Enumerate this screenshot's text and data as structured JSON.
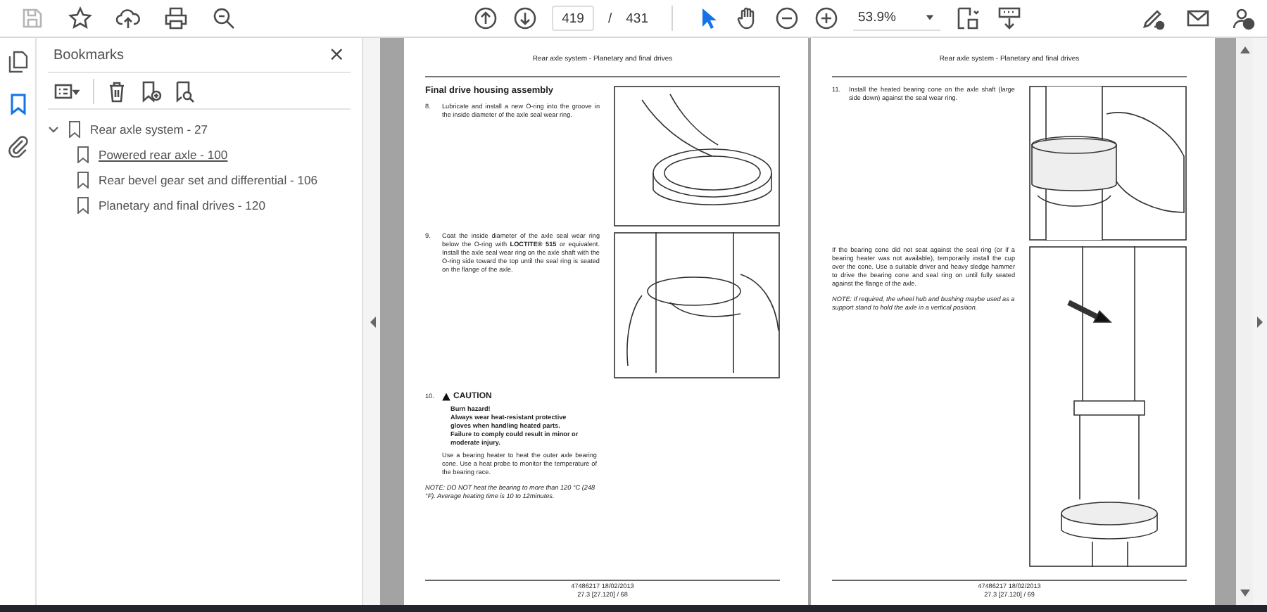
{
  "toolbar": {
    "page_number": "419",
    "page_separator": "/",
    "page_count": "431",
    "zoom": "53.9%",
    "tools": [
      {
        "kind": "select",
        "selected": true
      },
      {
        "kind": "hand",
        "selected": false
      }
    ]
  },
  "nav": [
    {
      "kind": "pages",
      "selected": false
    },
    {
      "kind": "bookmarks",
      "selected": true
    },
    {
      "kind": "attachments",
      "selected": false
    }
  ],
  "bookmarks": {
    "title": "Bookmarks",
    "close": "×",
    "items": [
      {
        "label": "Rear axle system - 27",
        "expanded": true,
        "selected": false,
        "children": [
          {
            "label": "Powered rear axle - 100",
            "selected": true
          },
          {
            "label": "Rear bevel gear set and differential - 106",
            "selected": false
          },
          {
            "label": "Planetary and final drives - 120",
            "selected": false
          }
        ]
      }
    ]
  },
  "pages": [
    {
      "header": "Rear axle system - Planetary and final drives",
      "rows": [
        {
          "figure": {
            "kind": "ring"
          },
          "blocks": [
            {
              "kind": "heading",
              "text": "Final drive housing assembly"
            },
            {
              "kind": "step",
              "number": "8.",
              "text": "Lubricate and install a new O-ring into the groove in the inside diameter of the axle seal wear ring."
            }
          ]
        },
        {
          "figure": {
            "kind": "hand"
          },
          "blocks": [
            {
              "kind": "step",
              "number": "9.",
              "text": "Coat the inside diameter of the axle seal wear ring below the O-ring with **LOCTITE® 515** or equivalent. Install the axle seal wear ring on the axle shaft with the O-ring side toward the top until the seal ring is seated on the flange of the axle."
            }
          ]
        },
        {
          "blocks": [
            {
              "kind": "caution",
              "number": "10.",
              "label": "CAUTION",
              "lines": [
                "Burn hazard!",
                "Always wear heat-resistant protective gloves when handling heated parts.",
                "Failure to comply could result in minor or moderate injury."
              ],
              "text": "Use a bearing heater to heat the outer axle bearing cone. Use a heat probe to monitor the temperature of the bearing race."
            },
            {
              "kind": "note",
              "text": "NOTE: DO NOT heat the bearing to more than 120 °C (248 °F). Average heating time is 10 to 12minutes."
            }
          ]
        }
      ],
      "footer": [
        "47486217 18/02/2013",
        "27.3 [27.120] / 68"
      ]
    },
    {
      "header": "Rear axle system - Planetary and final drives",
      "rows": [
        {
          "figure": {
            "kind": "bearing"
          },
          "blocks": [
            {
              "kind": "step",
              "number": "11.",
              "text": "Install the heated bearing cone on the axle shaft (large side down) against the seal wear ring."
            }
          ]
        },
        {
          "figure": {
            "kind": "shaft"
          },
          "blocks": [
            {
              "kind": "paragraph",
              "text": "If the bearing cone did not seat against the seal ring (or if a bearing heater was not available), temporarily install the cup over the cone. Use a suitable driver and heavy sledge hammer to drive the bearing cone and seal ring on until fully seated against the flange of the axle."
            },
            {
              "kind": "note",
              "text": "NOTE: If required, the wheel hub and bushing maybe used as a support stand to hold the axle in a vertical position."
            }
          ]
        }
      ],
      "footer": [
        "47486217 18/02/2013",
        "27.3 [27.120] / 69"
      ]
    }
  ]
}
